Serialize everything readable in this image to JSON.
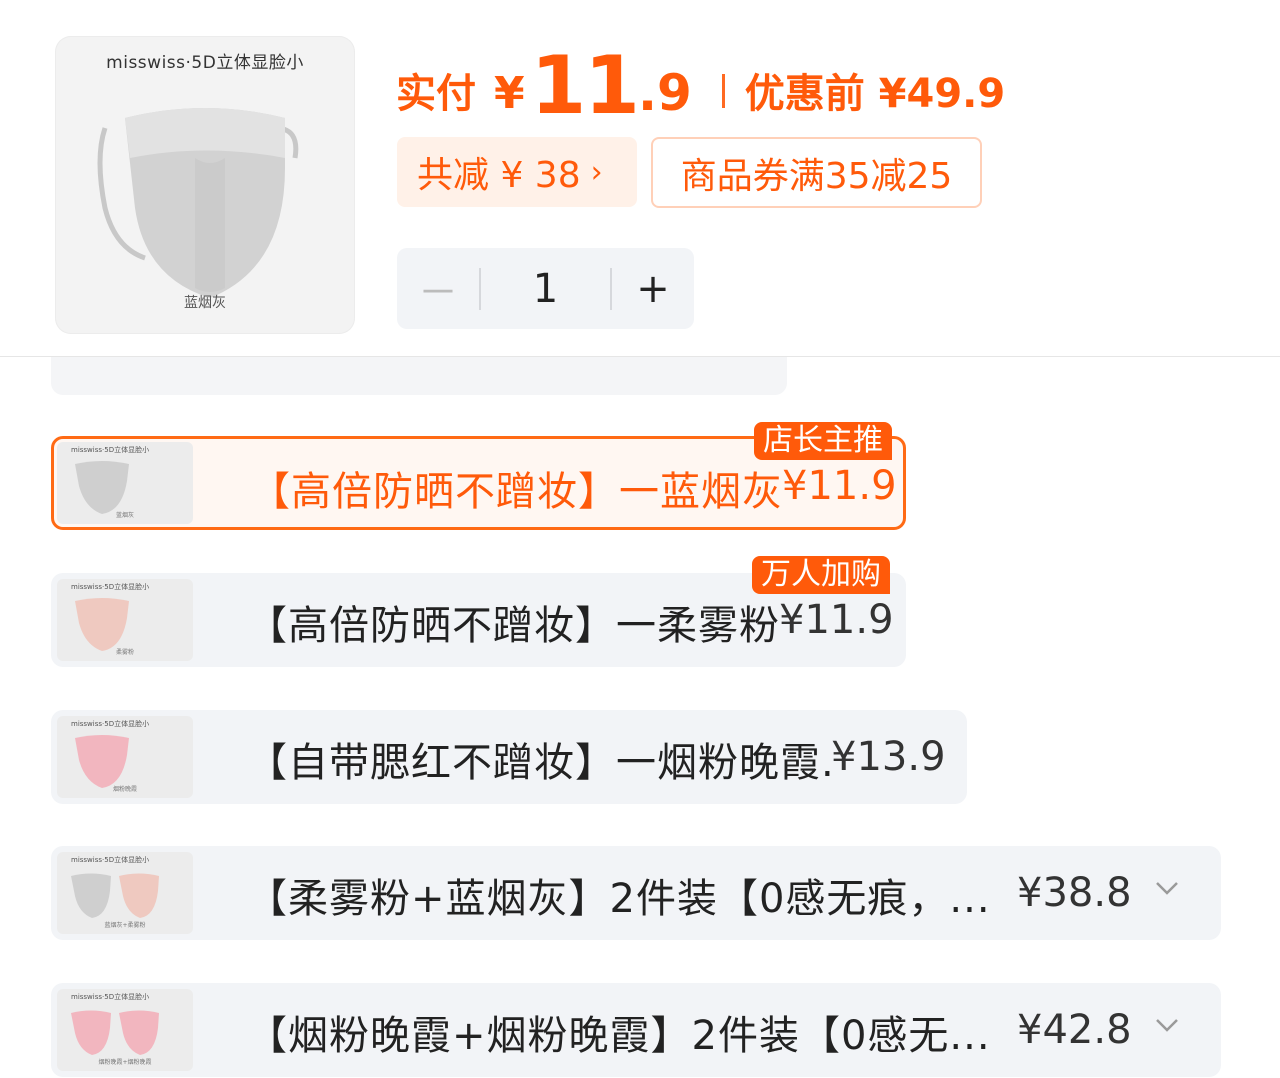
{
  "colors": {
    "accent": "#ff5a0a",
    "chip_bg": "#fff1e8",
    "row_bg": "#f2f4f7"
  },
  "product": {
    "brand": "misswiss·5D立体显脸小",
    "variant": "蓝烟灰"
  },
  "price": {
    "label": "实付",
    "currency": "¥",
    "int": "11",
    "dec": ".9",
    "orig_label": "优惠前 ¥49.9"
  },
  "discount": {
    "total": "共减 ¥ 38",
    "total_chevron": "›",
    "coupon": "商品券满35减25"
  },
  "quantity": {
    "minus": "－",
    "value": "1",
    "plus": "+"
  },
  "skus": [
    {
      "name": "【高倍防晒不蹭妆】一蓝烟灰",
      "price": "¥11.9",
      "badge": "店长主推",
      "thumb_brand": "misswiss·5D立体显脸小",
      "thumb_sub": "蓝烟灰",
      "selected": true
    },
    {
      "name": "【高倍防晒不蹭妆】一柔雾粉",
      "price": "¥11.9",
      "badge": "万人加购",
      "thumb_brand": "misswiss·5D立体显脸小",
      "thumb_sub": "柔雾粉",
      "selected": false
    },
    {
      "name": "【自带腮红不蹭妆】一烟粉晚霞.",
      "price": "¥13.9",
      "badge": "",
      "thumb_brand": "misswiss·5D立体显脸小",
      "thumb_sub": "烟粉晚霞",
      "selected": false
    },
    {
      "name": "【柔雾粉+蓝烟灰】2件装【0感无痕，...",
      "price": "¥38.8",
      "badge": "",
      "thumb_brand": "misswiss·5D立体显脸小",
      "thumb_sub": "蓝烟灰+柔雾粉",
      "selected": false
    },
    {
      "name": "【烟粉晚霞+烟粉晚霞】2件装【0感无...",
      "price": "¥42.8",
      "badge": "",
      "thumb_brand": "misswiss·5D立体显脸小",
      "thumb_sub": "烟粉晚霞+烟粉晚霞",
      "selected": false
    }
  ]
}
